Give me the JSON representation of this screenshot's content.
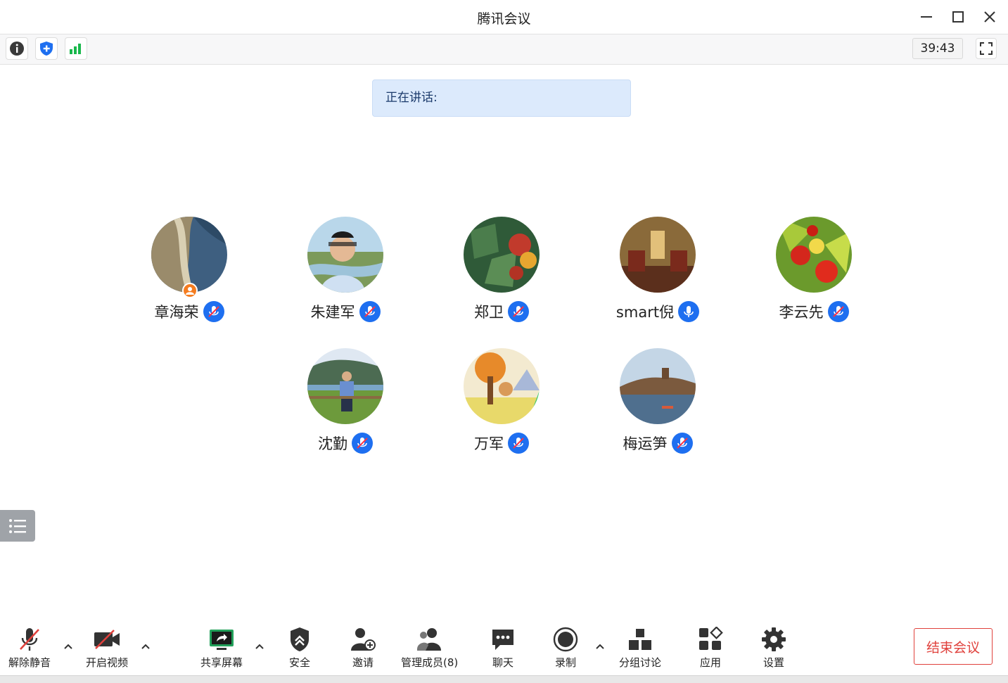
{
  "window": {
    "title": "腾讯会议"
  },
  "top_toolbar": {
    "timer": "39:43",
    "icons": [
      "info-icon",
      "shield-icon",
      "signal-icon",
      "fullscreen-icon"
    ]
  },
  "speaking": {
    "label": "正在讲话:"
  },
  "participants": [
    {
      "name": "章海荣",
      "host": true,
      "mic": "muted"
    },
    {
      "name": "朱建军",
      "host": false,
      "mic": "muted"
    },
    {
      "name": "郑卫",
      "host": false,
      "mic": "muted"
    },
    {
      "name": "smart倪",
      "host": false,
      "mic": "on"
    },
    {
      "name": "李云先",
      "host": false,
      "mic": "muted"
    },
    {
      "name": "沈勤",
      "host": false,
      "mic": "muted"
    },
    {
      "name": "万军",
      "host": false,
      "mic": "muted"
    },
    {
      "name": "梅运笋",
      "host": false,
      "mic": "muted"
    }
  ],
  "bottom_bar": {
    "unmute": "解除静音",
    "start_video": "开启视频",
    "share_screen": "共享屏幕",
    "security": "安全",
    "invite": "邀请",
    "manage_members": "管理成员(8)",
    "chat": "聊天",
    "record": "录制",
    "breakout": "分组讨论",
    "apps": "应用",
    "settings": "设置",
    "end_meeting": "结束会议"
  },
  "colors": {
    "accent_blue": "#1e6ff0",
    "end_red": "#e0413c",
    "host_orange": "#f57c1f",
    "signal_green": "#19b84c",
    "share_green": "#22a05a"
  }
}
